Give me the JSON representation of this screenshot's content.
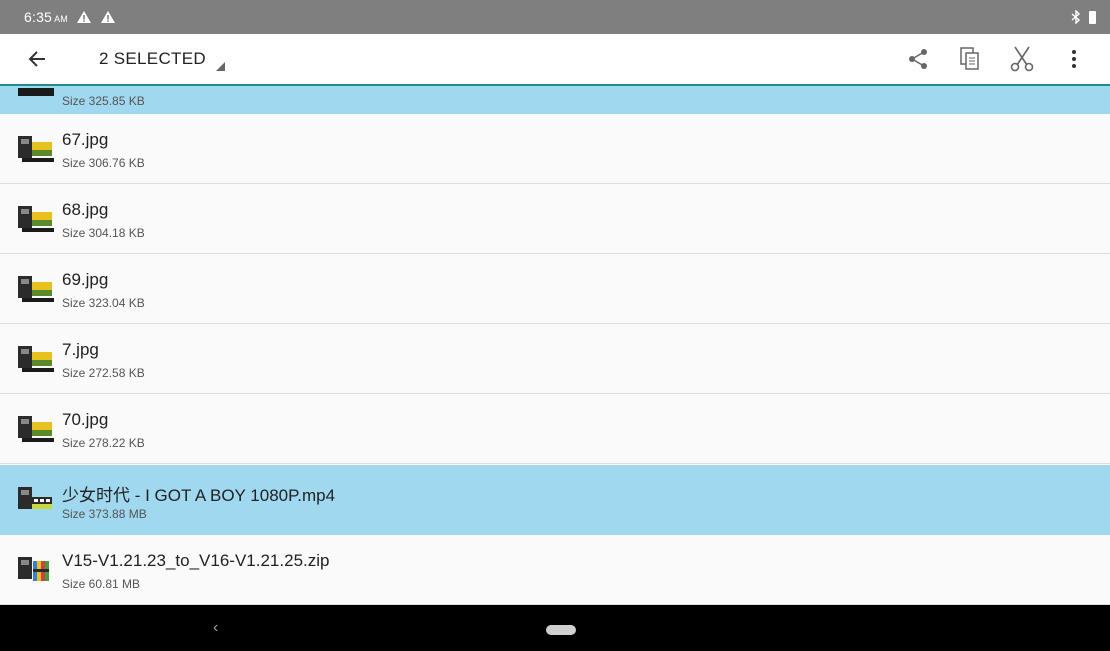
{
  "status_bar": {
    "time": "6:35",
    "ampm": "AM",
    "icons": [
      "warning-icon",
      "warning-icon",
      "bluetooth-icon",
      "battery-icon"
    ]
  },
  "action_bar": {
    "selected_label": "2 SELECTED",
    "actions": [
      "share-icon",
      "copy-icon",
      "cut-icon",
      "more-icon"
    ]
  },
  "colors": {
    "status_bar": "#7f7f7f",
    "selected_row": "#9fd8ef",
    "accent_line": "#1f8a8a"
  },
  "files": [
    {
      "name": "",
      "size": "Size 325.85 KB",
      "selected": true,
      "icon": "image-file-icon"
    },
    {
      "name": "67.jpg",
      "size": "Size 306.76 KB",
      "selected": false,
      "icon": "image-file-icon"
    },
    {
      "name": "68.jpg",
      "size": "Size 304.18 KB",
      "selected": false,
      "icon": "image-file-icon"
    },
    {
      "name": "69.jpg",
      "size": "Size 323.04 KB",
      "selected": false,
      "icon": "image-file-icon"
    },
    {
      "name": "7.jpg",
      "size": "Size 272.58 KB",
      "selected": false,
      "icon": "image-file-icon"
    },
    {
      "name": "70.jpg",
      "size": "Size 278.22 KB",
      "selected": false,
      "icon": "image-file-icon"
    },
    {
      "name": "少女时代 - I GOT A BOY 1080P.mp4",
      "size": "Size 373.88 MB",
      "selected": true,
      "icon": "video-file-icon"
    },
    {
      "name": "V15-V1.21.23_to_V16-V1.21.25.zip",
      "size": "Size 60.81 MB",
      "selected": false,
      "icon": "archive-file-icon"
    }
  ],
  "nav_bar": {
    "back": "‹"
  }
}
